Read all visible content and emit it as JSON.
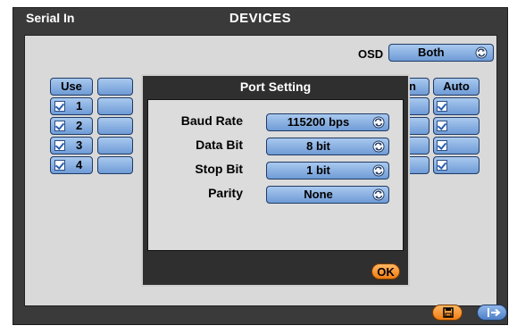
{
  "window": {
    "left_title": "Serial In",
    "center_title": "DEVICES"
  },
  "osd": {
    "label": "OSD",
    "value": "Both"
  },
  "table": {
    "headers": [
      "Use",
      "",
      "n",
      "Auto"
    ],
    "rows": [
      {
        "num": "1",
        "use_checked": true,
        "auto_checked": true
      },
      {
        "num": "2",
        "use_checked": true,
        "auto_checked": true
      },
      {
        "num": "3",
        "use_checked": true,
        "auto_checked": true
      },
      {
        "num": "4",
        "use_checked": true,
        "auto_checked": true
      }
    ]
  },
  "modal": {
    "title": "Port Setting",
    "settings": [
      {
        "label": "Baud Rate",
        "value": "115200 bps"
      },
      {
        "label": "Data Bit",
        "value": "8 bit"
      },
      {
        "label": "Stop Bit",
        "value": "1 bit"
      },
      {
        "label": "Parity",
        "value": "None"
      }
    ],
    "ok_label": "OK"
  },
  "icons": {
    "sync": "sync-icon",
    "save": "save-icon",
    "exit": "exit-icon"
  },
  "colors": {
    "pill_blue": "#7fa7dc",
    "ok_orange": "#f49a34",
    "window_dark": "#3a3a3a"
  }
}
